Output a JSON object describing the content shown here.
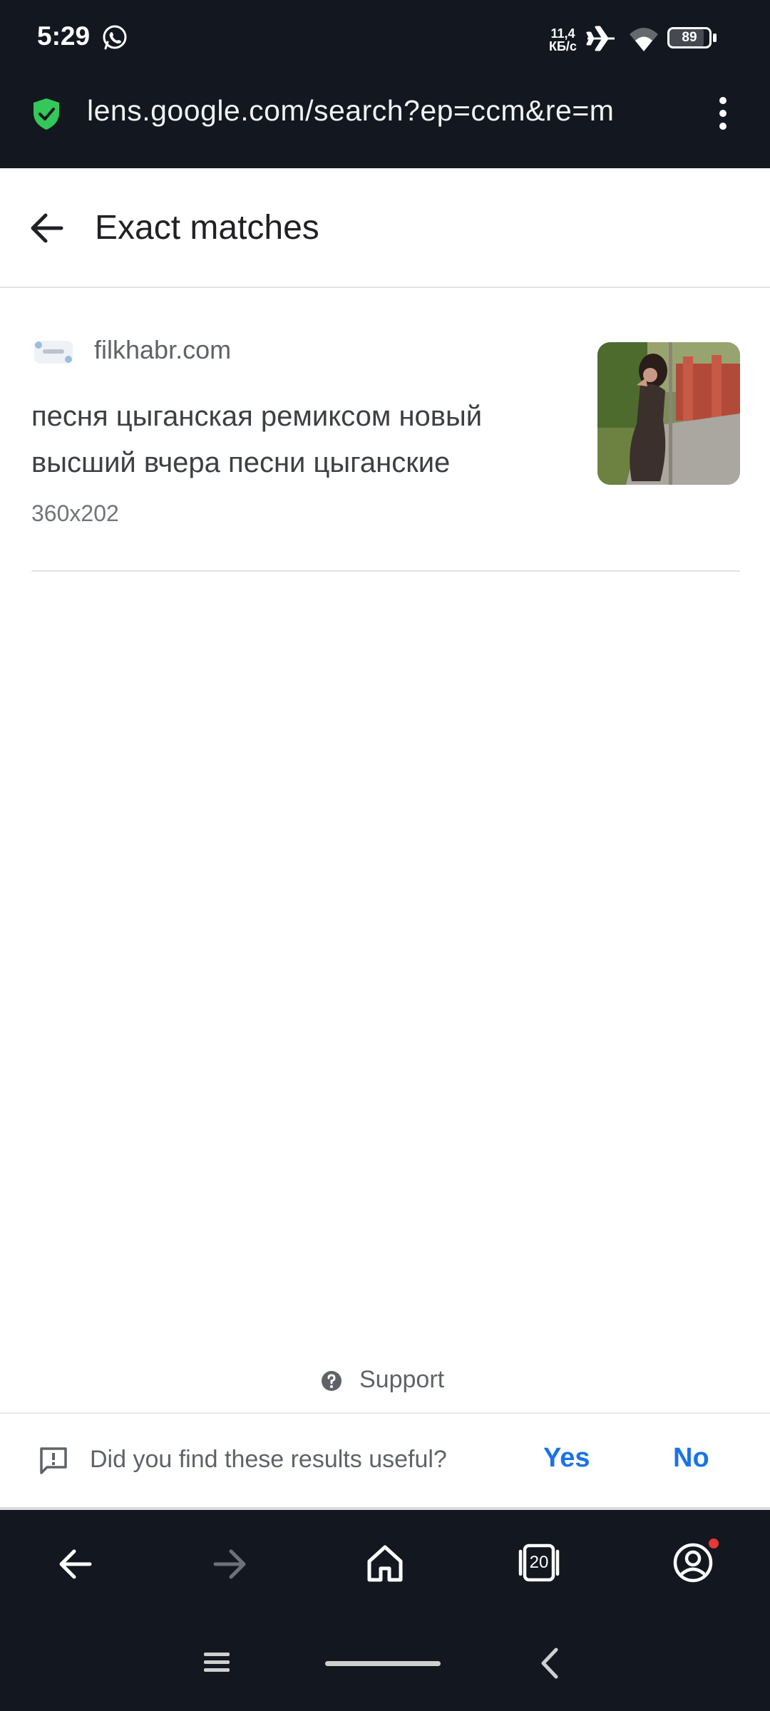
{
  "status_bar": {
    "time": "5:29",
    "net_speed_value": "11,4",
    "net_speed_unit": "КБ/с",
    "battery": "89"
  },
  "url_bar": {
    "url": "lens.google.com/search?ep=ccm&re=m"
  },
  "header": {
    "title": "Exact matches"
  },
  "result": {
    "site": "filkhabr.com",
    "title": "песня цыганская ремиксом новый высший вчера песни цыганские",
    "dimensions": "360x202"
  },
  "support": {
    "label": "Support"
  },
  "feedback": {
    "question": "Did you find these results useful?",
    "yes": "Yes",
    "no": "No"
  },
  "bottom_nav": {
    "tab_count": "20"
  },
  "colors": {
    "dark_bar": "#131720",
    "accent_blue": "#1a73e8",
    "secure_green": "#34c759"
  }
}
